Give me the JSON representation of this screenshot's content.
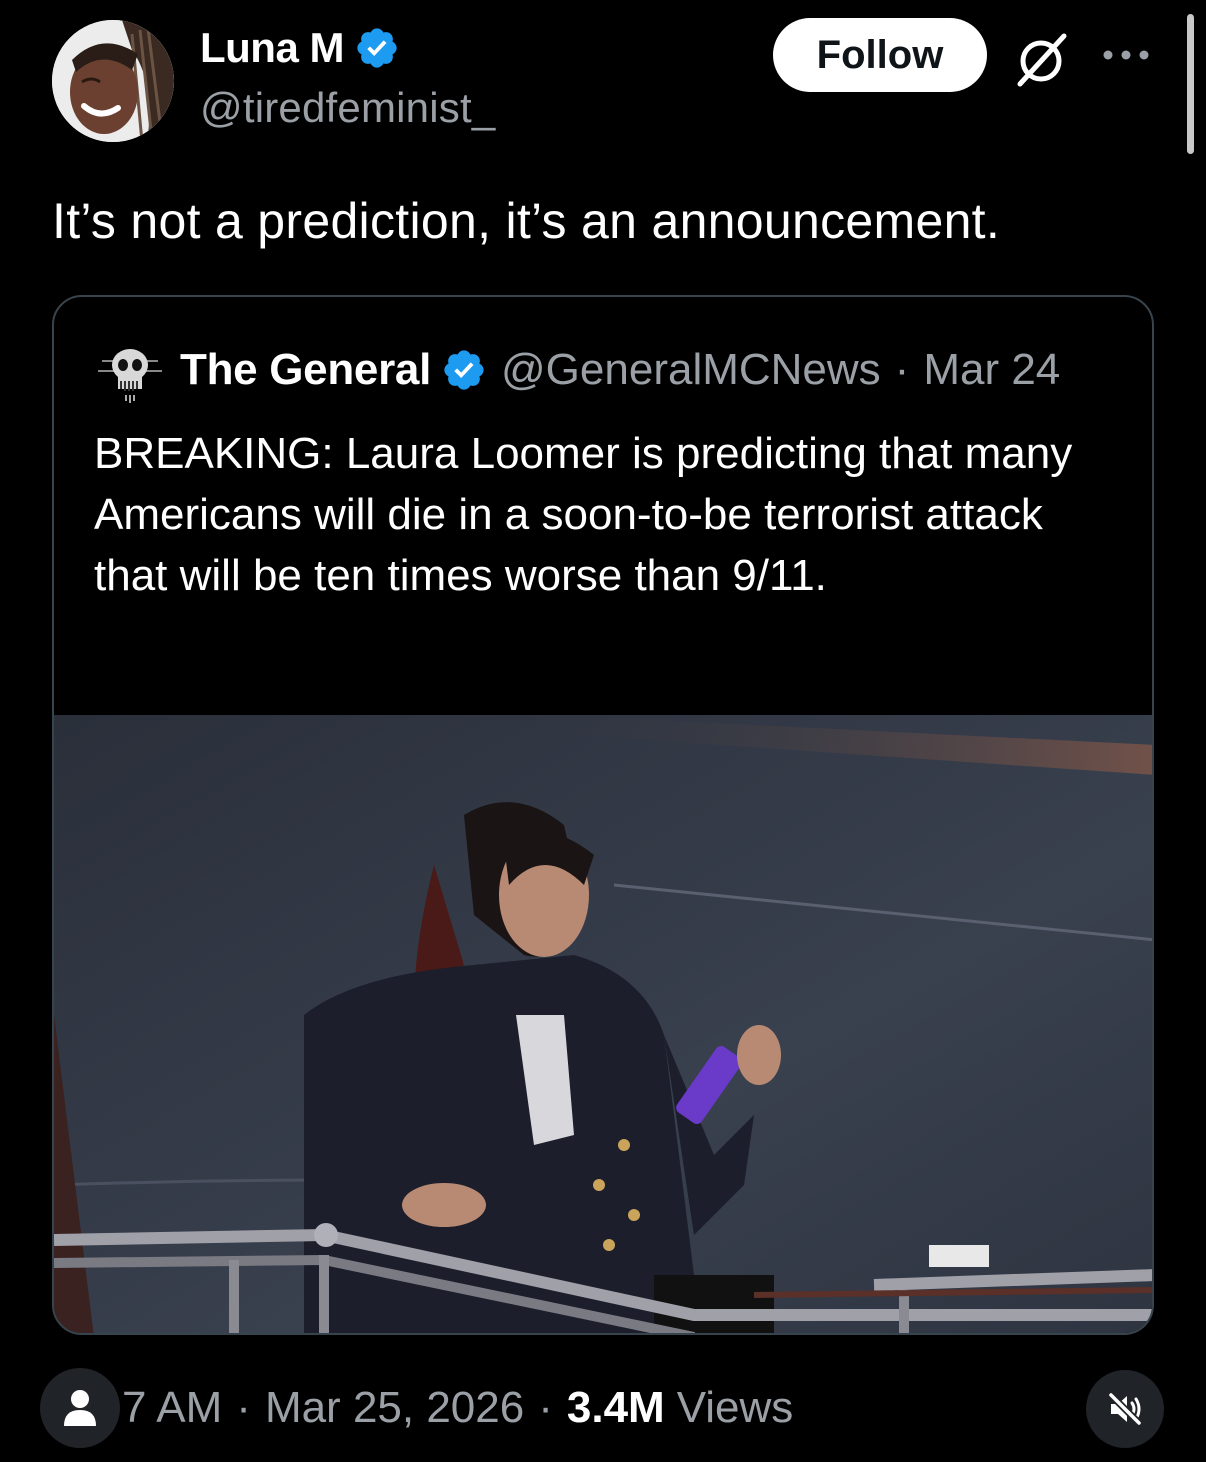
{
  "author": {
    "name": "Luna M",
    "handle": "@tiredfeminist_",
    "verified": true,
    "avatar_icon": "profile-photo"
  },
  "actions": {
    "follow_label": "Follow",
    "grok_icon": "grok-icon",
    "more_icon": "more-dots-icon"
  },
  "tweet": {
    "text": "It’s not a prediction, it’s an announcement."
  },
  "quoted": {
    "name": "The General",
    "handle": "@GeneralMCNews",
    "separator": "·",
    "date": "Mar 24",
    "verified": true,
    "avatar_icon": "skull-emblem",
    "text": "BREAKING: Laura Loomer is predicting that many Americans will die in a soon-to-be terrorist attack that will be ten times worse than 9/11.",
    "media": "photo of woman in navy blazer descending airplane stairs holding a phone"
  },
  "footer": {
    "time": "7 AM",
    "date": "Mar 25, 2026",
    "views_count": "3.4M",
    "views_label": "Views",
    "separator": "·"
  },
  "colors": {
    "background": "#000000",
    "verified_blue": "#1d9bf0",
    "muted_text": "#9aa0a6",
    "border": "#38444d"
  }
}
